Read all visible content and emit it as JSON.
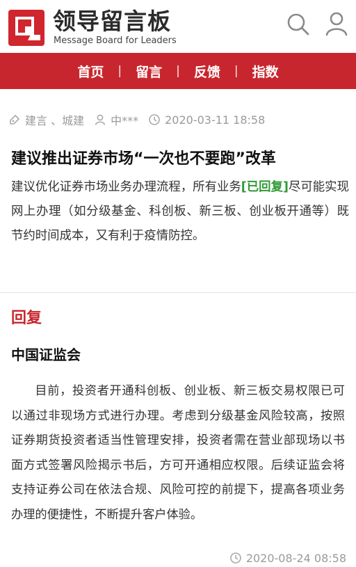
{
  "header": {
    "title": "领导留言板",
    "subtitle": "Message Board for Leaders"
  },
  "nav": {
    "items": [
      "首页",
      "留言",
      "反馈",
      "指数"
    ],
    "separator": "|"
  },
  "meta": {
    "category": "建言 、城建",
    "author": "中***",
    "datetime": "2020-03-11 18:58"
  },
  "post": {
    "title": "建议推出证券市场“一次也不要跑”改革",
    "body_lead": "建议优化证券市场业务办理流程，所有业务",
    "status_tag": "[已回复]",
    "body_rest": "尽可能实现网上办理（如分级基金、科创板、新三板、创业板开通等）既节约时间成本，又有利于疫情防控。"
  },
  "reply": {
    "heading": "回复",
    "org": "中国证监会",
    "body": "目前，投资者开通科创板、创业板、新三板交易权限已可以通过非现场方式进行办理。考虑到分级基金风险较高，按照证券期货投资者适当性管理安排，投资者需在营业部现场以书面方式签署风险揭示书后，方可开通相应权限。后续证监会将支持证券公司在依法合规、风险可控的前提下，提高各项业务办理的便捷性，不断提升客户体验。",
    "datetime": "2020-08-24 08:58"
  },
  "colors": {
    "brand_red": "#c8262e",
    "replied_green": "#2e9a35",
    "meta_gray": "#9a9a9a"
  },
  "icons": {
    "logo": "logo-icon",
    "search": "search-icon",
    "user": "user-icon",
    "category": "tag-icon",
    "author": "user-icon",
    "time": "clock-icon"
  }
}
